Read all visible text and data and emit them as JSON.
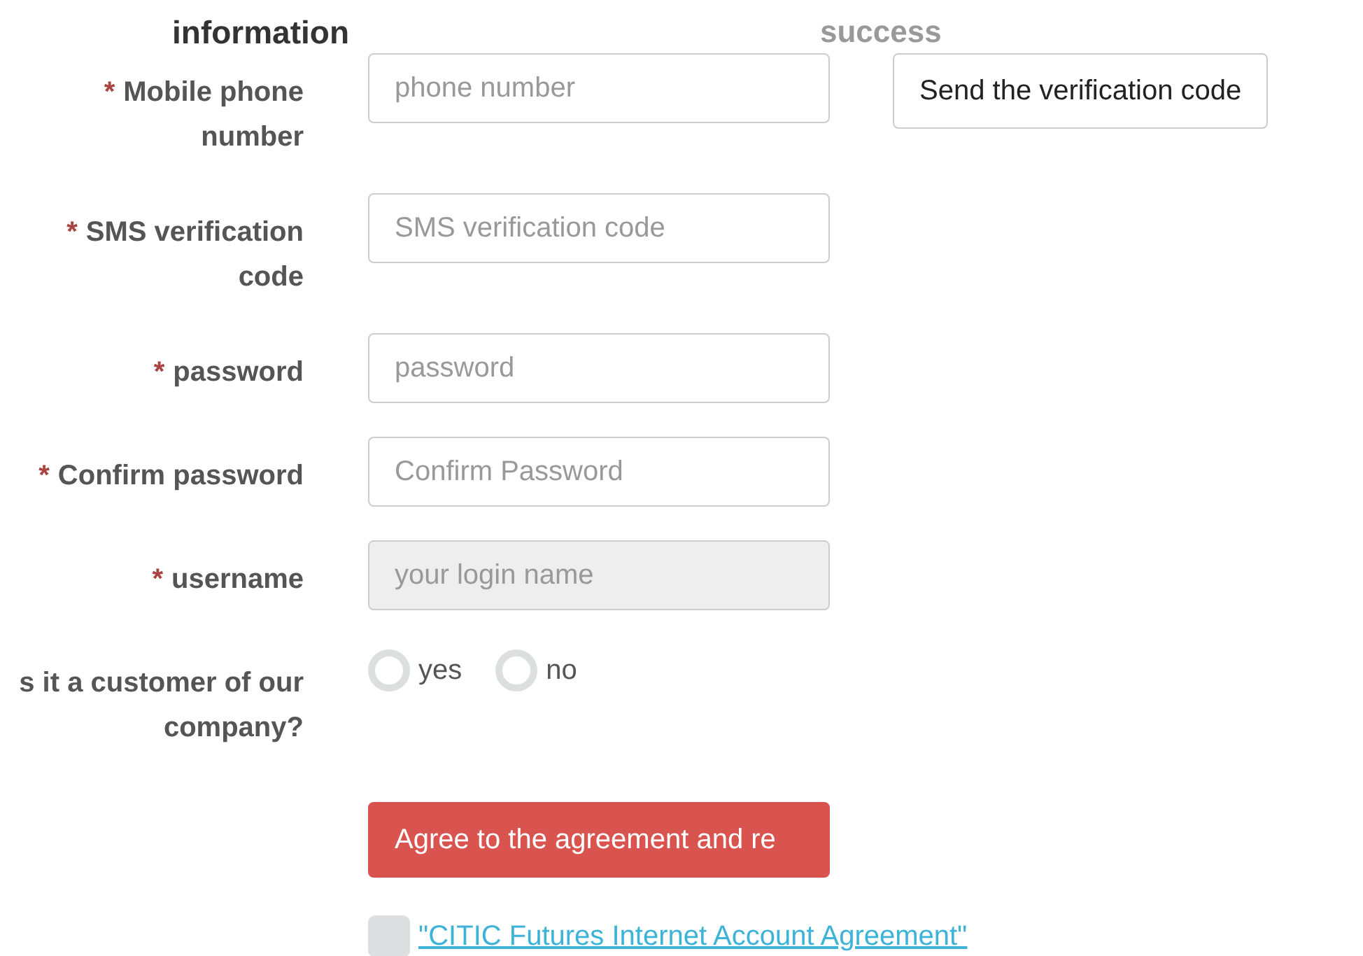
{
  "steps": [
    {
      "label": "information",
      "selected": true
    },
    {
      "label": "success",
      "selected": false
    }
  ],
  "fields": [
    {
      "label": "Mobile phone number",
      "required_mark": "*",
      "placeholder": "phone number",
      "disabled": false,
      "action": "Send the verification code"
    },
    {
      "label": "SMS verification code",
      "required_mark": "*",
      "placeholder": "SMS verification code",
      "disabled": false
    },
    {
      "label": "password",
      "required_mark": "*",
      "placeholder": "password",
      "disabled": false
    },
    {
      "label": "Confirm password",
      "required_mark": "*",
      "placeholder": "Confirm Password",
      "disabled": false
    },
    {
      "label": "username",
      "required_mark": "*",
      "placeholder": "your login name",
      "disabled": true
    }
  ],
  "customer_question": {
    "label": "s it a customer of our company?",
    "options": [
      {
        "label": "yes",
        "selected": false
      },
      {
        "label": "no",
        "selected": false
      }
    ]
  },
  "submit_button": "Agree to the agreement and re",
  "agreement": {
    "checked": false,
    "link": "\"CITIC Futures Internet Account Agreement\""
  }
}
